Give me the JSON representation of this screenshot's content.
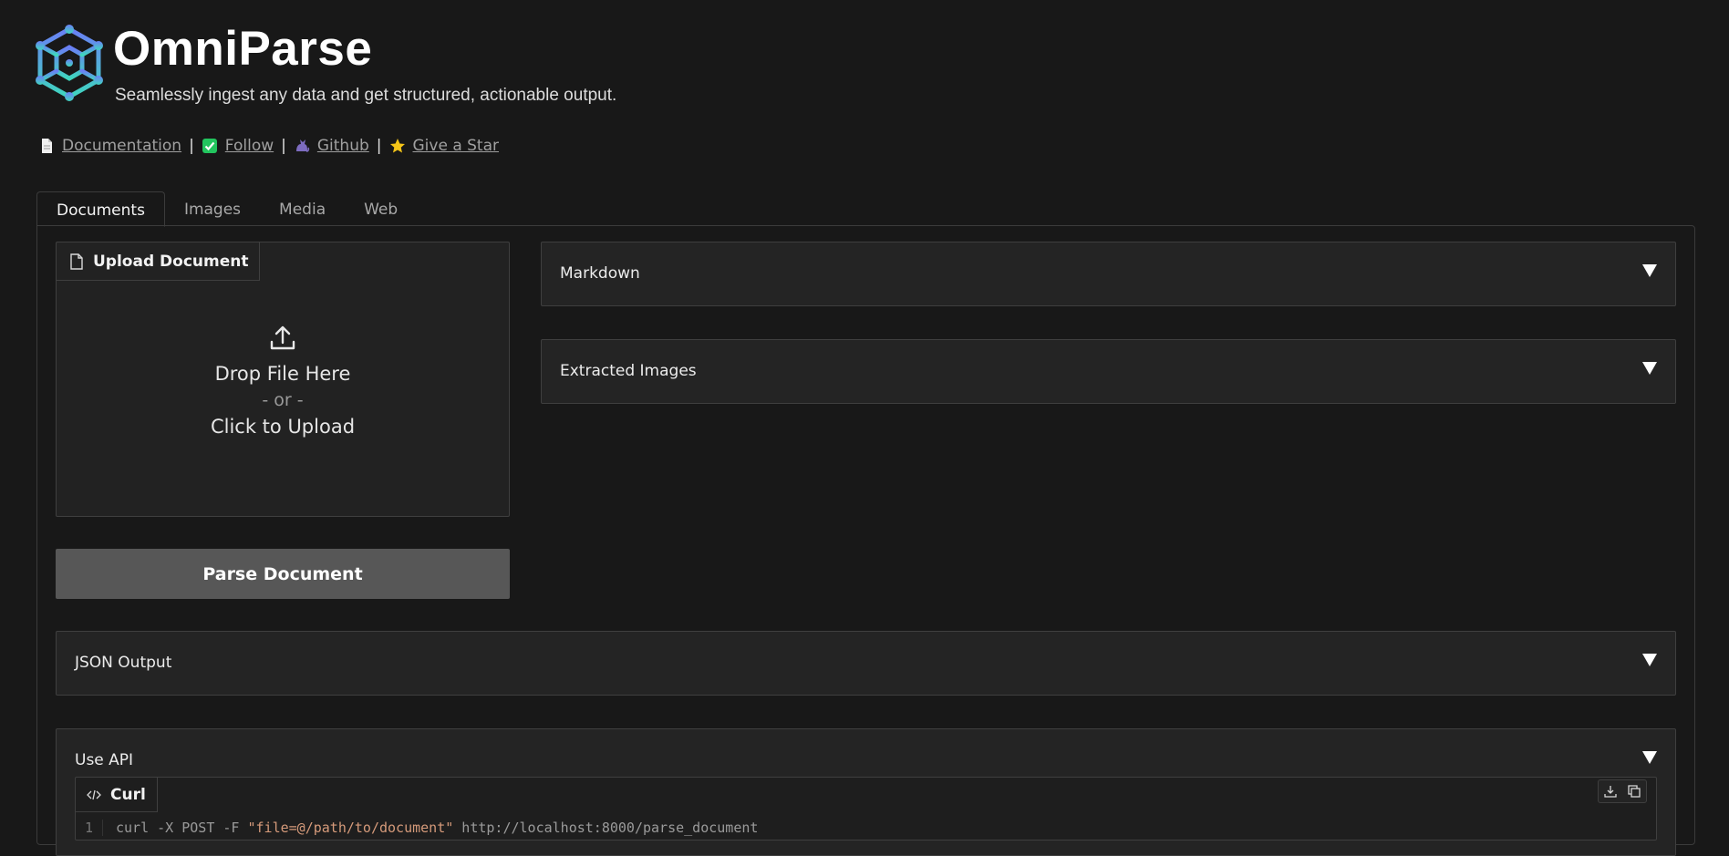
{
  "header": {
    "title": "OmniParse",
    "subtitle": "Seamlessly ingest any data and get structured, actionable output."
  },
  "links": [
    {
      "label": "Documentation",
      "icon": "document-icon"
    },
    {
      "label": "Follow",
      "icon": "checkmark-icon"
    },
    {
      "label": "Github",
      "icon": "cat-icon"
    },
    {
      "label": "Give a Star",
      "icon": "star-icon"
    }
  ],
  "link_separator": "|",
  "tabs": [
    {
      "label": "Documents",
      "active": true
    },
    {
      "label": "Images",
      "active": false
    },
    {
      "label": "Media",
      "active": false
    },
    {
      "label": "Web",
      "active": false
    }
  ],
  "upload": {
    "label": "Upload Document",
    "drop_text": "Drop File Here",
    "or_text": "- or -",
    "click_text": "Click to Upload"
  },
  "parse_button": "Parse Document",
  "accordions": {
    "markdown": "Markdown",
    "extracted_images": "Extracted Images",
    "json_output": "JSON Output",
    "use_api": "Use API"
  },
  "code": {
    "label": "Curl",
    "line_number": "1",
    "cmd_start": "curl -X POST -F ",
    "cmd_string": "\"file=@/path/to/document\"",
    "cmd_end": " http://localhost:8000/parse_document"
  },
  "colors": {
    "background": "#181818",
    "panel": "#242424",
    "border": "#3f3f3f",
    "button": "#575757",
    "logo_blue": "#5b8cf0",
    "logo_teal": "#3fd0c0"
  }
}
